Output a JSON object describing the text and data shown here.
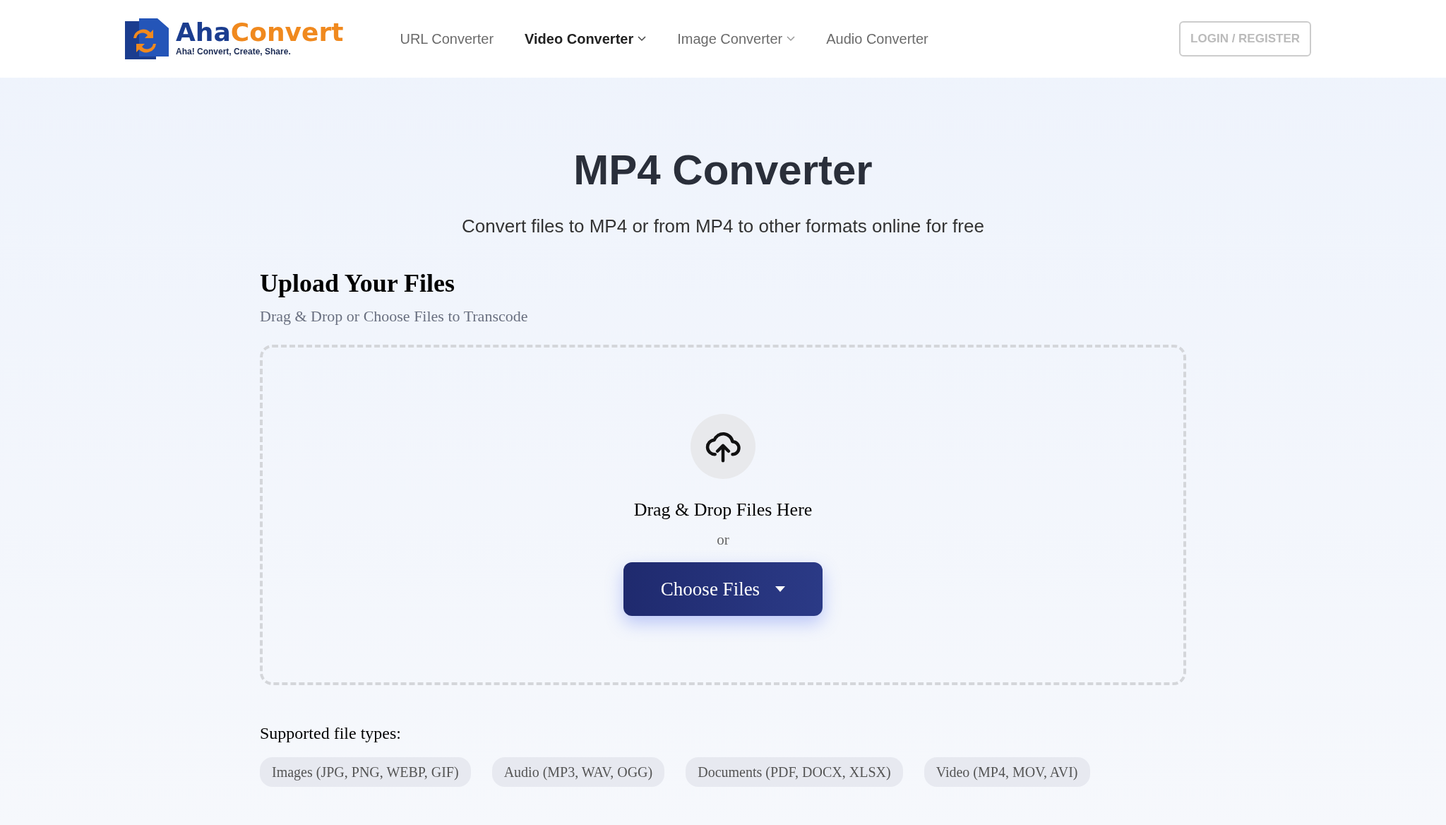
{
  "header": {
    "logo": {
      "name_first": "Aha",
      "name_second": "Convert",
      "tagline": "Aha! Convert, Create, Share."
    },
    "nav": [
      {
        "label": "URL Converter",
        "selected": false,
        "dropdown": false
      },
      {
        "label": "Video Converter",
        "selected": true,
        "dropdown": true
      },
      {
        "label": "Image Converter",
        "selected": false,
        "dropdown": true
      },
      {
        "label": "Audio Converter",
        "selected": false,
        "dropdown": false
      }
    ],
    "login_button": "LOGIN / REGISTER"
  },
  "hero": {
    "title": "MP4 Converter",
    "subtitle": "Convert files to MP4 or from MP4 to other formats online for free"
  },
  "upload": {
    "heading": "Upload Your Files",
    "hint": "Drag & Drop or Choose Files to Transcode",
    "dropzone": {
      "prompt": "Drag & Drop Files Here",
      "or": "or",
      "button": "Choose Files"
    }
  },
  "supported": {
    "label": "Supported file types:",
    "types": [
      "Images (JPG, PNG, WEBP, GIF)",
      "Audio (MP3, WAV, OGG)",
      "Documents (PDF, DOCX, XLSX)",
      "Video (MP4, MOV, AVI)"
    ]
  }
}
